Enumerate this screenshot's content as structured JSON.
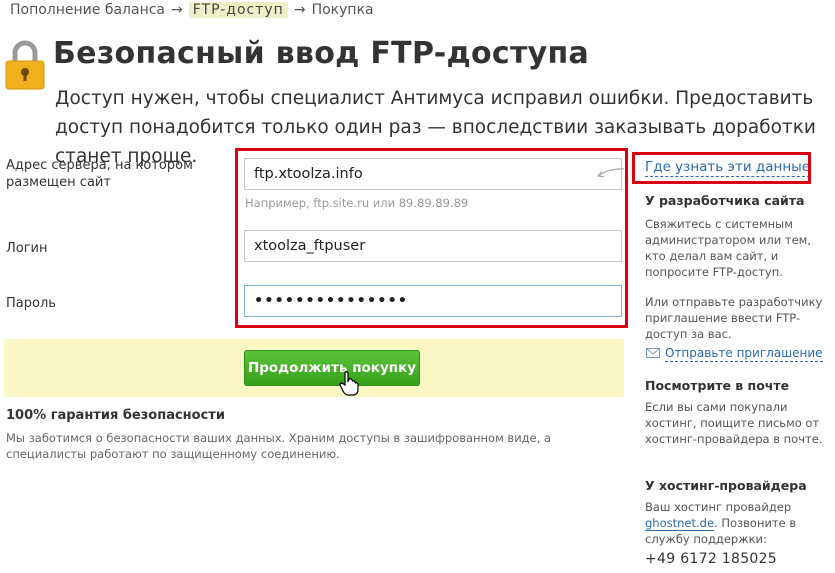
{
  "breadcrumb": {
    "items": [
      "Пополнение баланса",
      "FTP-доступ",
      "Покупка"
    ],
    "separator": "→"
  },
  "header": {
    "title": "Безопасный ввод FTP-доступа",
    "subtitle": "Доступ нужен, чтобы специалист Антимуса исправил ошибки. Предоставить доступ понадобится только один раз — впоследствии заказывать доработки станет проще."
  },
  "form": {
    "server_label": "Адрес сервера, на котором размещен сайт",
    "server_value": "ftp.xtoolza.info",
    "server_hint": "Например, ftp.site.ru или 89.89.89.89",
    "login_label": "Логин",
    "login_value": "xtoolza_ftpuser",
    "password_label": "Пароль",
    "password_value": "•••••••••••••••",
    "submit_label": "Продолжить покупку"
  },
  "guarantee": {
    "title": "100% гарантия безопасности",
    "text": "Мы заботимся о безопасности ваших данных. Храним доступы в зашифрованном виде, а специалисты работают по защищенному соединению."
  },
  "sidebar": {
    "help_link": "Где узнать эти данные",
    "dev_title": "У разработчика сайта",
    "dev_text": "Свяжитесь с системным администратором или тем, кто делал вам сайт, и попросите FTP-доступ.",
    "dev_text2": "Или отправьте разработчику приглашение ввести FTP-доступ за вас.",
    "invite_link": "Отправьте приглашение",
    "mail_title": "Посмотрите в почте",
    "mail_text": "Если вы сами покупали хостинг, поищите письмо от хостинг-провайдера в почте.",
    "hosting_title": "У хостинг-провайдера",
    "hosting_text_before": "Ваш хостинг провайдер",
    "hosting_link": "ghostnet.de",
    "hosting_text_after": ". Позвоните в службу поддержки:",
    "phone": "+49 6172 185025"
  },
  "colors": {
    "accent_red": "#d9000f",
    "button_green": "#37a11c",
    "link_blue": "#2a6ab0",
    "highlight_yellow": "#fbf8c6"
  },
  "icons": [
    "lock-icon",
    "mail-icon",
    "hand-cursor-icon",
    "curved-arrow-icon"
  ]
}
